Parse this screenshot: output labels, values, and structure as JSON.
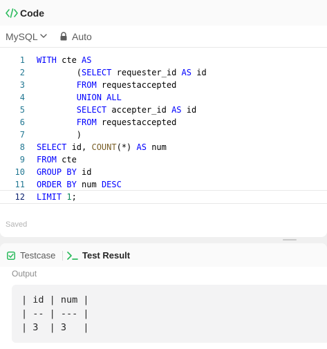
{
  "header": {
    "title": "Code",
    "icon": "code-icon"
  },
  "toolbar": {
    "language": "MySQL",
    "mode": "Auto"
  },
  "editor": {
    "lines": [
      {
        "n": "1",
        "text": "WITH cte AS"
      },
      {
        "n": "2",
        "text": "        (SELECT requester_id AS id"
      },
      {
        "n": "3",
        "text": "        FROM requestaccepted"
      },
      {
        "n": "4",
        "text": "        UNION ALL"
      },
      {
        "n": "5",
        "text": "        SELECT accepter_id AS id"
      },
      {
        "n": "6",
        "text": "        FROM requestaccepted"
      },
      {
        "n": "7",
        "text": "        )"
      },
      {
        "n": "8",
        "text": "SELECT id, COUNT(*) AS num"
      },
      {
        "n": "9",
        "text": "FROM cte"
      },
      {
        "n": "10",
        "text": "GROUP BY id"
      },
      {
        "n": "11",
        "text": "ORDER BY num DESC"
      },
      {
        "n": "12",
        "text": "LIMIT 1;"
      }
    ],
    "active_line": "12"
  },
  "status": {
    "saved": "Saved"
  },
  "tabs": [
    {
      "label": "Testcase",
      "icon": "checkbox-icon",
      "active": false
    },
    {
      "label": "Test Result",
      "icon": "terminal-icon",
      "active": true
    }
  ],
  "result": {
    "label": "Output",
    "lines": [
      "| id | num |",
      "| -- | --- |",
      "| 3  | 3   |"
    ]
  },
  "colors": {
    "keyword": "#0000ff",
    "function": "#795e26",
    "number": "#098658",
    "line_number": "#237893",
    "accent_green": "#2cbb5d"
  }
}
